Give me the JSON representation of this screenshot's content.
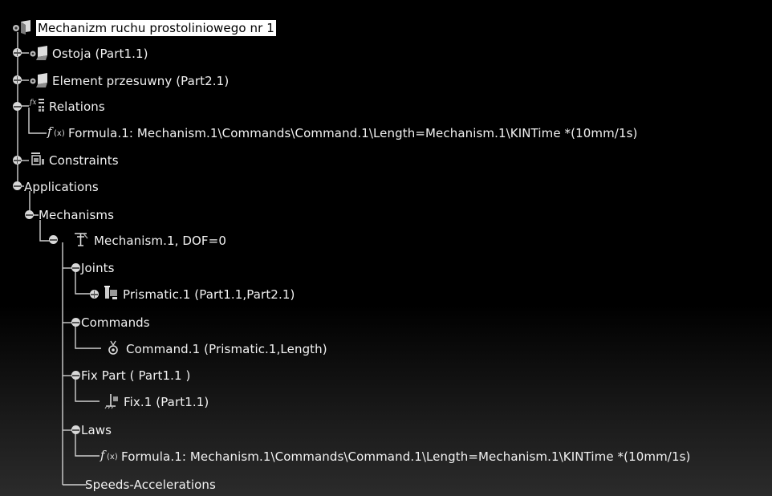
{
  "tree": {
    "root": {
      "label": "Mechanizm ruchu prostoliniowego nr 1",
      "icon": "product-icon"
    },
    "ostoja": {
      "label": "Ostoja (Part1.1)",
      "icon": "part-icon"
    },
    "element": {
      "label": "Element przesuwny (Part2.1)",
      "icon": "part-icon"
    },
    "relations": {
      "label": "Relations",
      "icon": "relations-icon"
    },
    "formula1": {
      "label": "Formula.1: Mechanism.1\\Commands\\Command.1\\Length=Mechanism.1\\KINTime *(10mm/1s)",
      "icon": "formula-icon"
    },
    "constraints": {
      "label": "Constraints",
      "icon": "constraints-icon"
    },
    "applications": {
      "label": "Applications"
    },
    "mechanisms": {
      "label": "Mechanisms"
    },
    "mechanism1": {
      "label": "Mechanism.1, DOF=0",
      "icon": "mechanism-icon"
    },
    "joints": {
      "label": "Joints"
    },
    "prismatic": {
      "label": "Prismatic.1 (Part1.1,Part2.1)",
      "icon": "prismatic-joint-icon"
    },
    "commands": {
      "label": "Commands"
    },
    "command1": {
      "label": "Command.1 (Prismatic.1,Length)",
      "icon": "command-icon"
    },
    "fixpart": {
      "label": "Fix Part ( Part1.1 )"
    },
    "fix1": {
      "label": "Fix.1 (Part1.1)",
      "icon": "fix-icon"
    },
    "laws": {
      "label": "Laws"
    },
    "formula2": {
      "label": "Formula.1: Mechanism.1\\Commands\\Command.1\\Length=Mechanism.1\\KINTime *(10mm/1s)",
      "icon": "formula-icon"
    },
    "speeds": {
      "label": "Speeds-Accelerations"
    }
  }
}
